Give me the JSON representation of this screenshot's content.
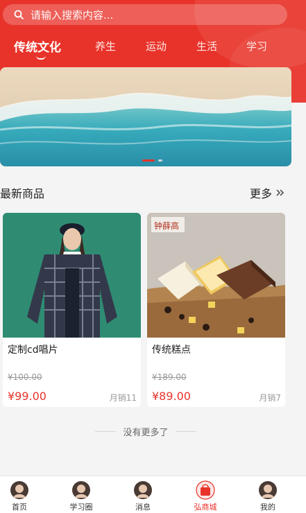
{
  "search": {
    "placeholder": "请输入搜索内容..."
  },
  "tabs": [
    "传统文化",
    "养生",
    "运动",
    "生活",
    "学习"
  ],
  "section": {
    "title": "最新商品",
    "more": "更多"
  },
  "products": [
    {
      "name": "定制cd唱片",
      "old_price": "¥100.00",
      "price": "¥99.00",
      "sales": "月销11"
    },
    {
      "name": "传统糕点",
      "old_price": "¥189.00",
      "price": "¥89.00",
      "sales": "月销7",
      "brand_text": "钟薛高"
    }
  ],
  "footer_note": "没有更多了",
  "tabbar": [
    "首页",
    "学习圈",
    "消息",
    "弘商城",
    "我的"
  ],
  "colors": {
    "brand_red": "#e8332a"
  }
}
